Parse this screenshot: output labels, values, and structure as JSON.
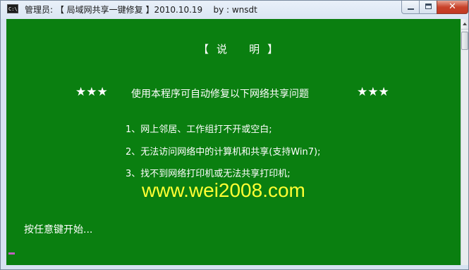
{
  "window": {
    "icon_label": "C:\\",
    "title": "管理员: 【 局域网共享一键修复 】2010.10.19    by : wnsdt",
    "close_label": "✕",
    "colors": {
      "console_background": "#0a7f10",
      "console_text": "#ffffff",
      "url_text": "#ffff33"
    }
  },
  "console": {
    "heading": "【 说   明 】",
    "stars_left": "★★★",
    "intro": "使用本程序可自动修复以下网络共享问题",
    "stars_right": "★★★",
    "items": [
      "1、网上邻居、工作组打不开或空白;",
      "2、无法访问网络中的计算机和共享(支持Win7);",
      "3、找不到网络打印机或无法共享打印机;"
    ],
    "url": "www.wei2008.com",
    "prompt": "按任意键开始..."
  }
}
